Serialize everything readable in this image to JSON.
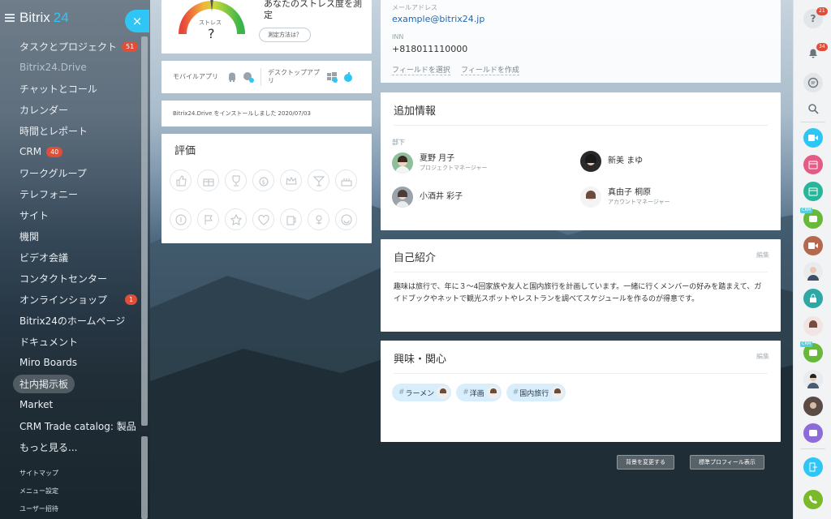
{
  "sidebar": {
    "logo_name": "Bitrix",
    "logo_num": "24",
    "items": [
      {
        "label": "タスクとプロジェクト",
        "badge": "51"
      },
      {
        "label": "Bitrix24.Drive"
      },
      {
        "label": "チャットとコール"
      },
      {
        "label": "カレンダー"
      },
      {
        "label": "時間とレポート"
      },
      {
        "label": "CRM",
        "badge": "40"
      },
      {
        "label": "ワークグループ"
      },
      {
        "label": "テレフォニー"
      },
      {
        "label": "サイト"
      },
      {
        "label": "機関"
      },
      {
        "label": "ビデオ会議"
      },
      {
        "label": "コンタクトセンター"
      },
      {
        "label": "オンラインショップ",
        "badge": "1"
      },
      {
        "label": "Bitrix24のホームページ"
      },
      {
        "label": "ドキュメント"
      },
      {
        "label": "Miro Boards"
      },
      {
        "label": "社内掲示板"
      },
      {
        "label": "Market"
      },
      {
        "label": "CRM Trade catalog: 製品"
      },
      {
        "label": "もっと見る..."
      }
    ],
    "footer": [
      "サイトマップ",
      "メニュー設定",
      "ユーザー招待"
    ],
    "close_glyph": "×"
  },
  "stress": {
    "title": "あなたのストレス度を測定",
    "gauge_label": "ストレス",
    "gauge_value": "?",
    "measure_button": "測定方法は？"
  },
  "apps": {
    "mobile_label": "モバイルアプリ",
    "desktop_label": "デスクトップアプリ"
  },
  "installed_text": "Bitrix24.Drive をインストールしました 2020/07/03",
  "awards": {
    "title": "評価"
  },
  "contact": {
    "email_label": "メールアドレス",
    "email": "example@bitrix24.jp",
    "inn_label": "INN",
    "inn": "+818011110000",
    "select_fields": "フィールドを選択",
    "create_field": "フィールドを作成"
  },
  "extra_info": {
    "title": "追加情報",
    "subordinates_label": "部下",
    "people": [
      {
        "name": "夏野 月子",
        "role": "プロジェクトマネージャー"
      },
      {
        "name": "新美 まゆ",
        "role": ""
      },
      {
        "name": "小酒井 彩子",
        "role": ""
      },
      {
        "name": "真由子 桐原",
        "role": "アカウントマネージャー"
      }
    ]
  },
  "intro": {
    "title": "自己紹介",
    "edit": "編集",
    "text": "趣味は旅行で、年に３〜4回家族や友人と国内旅行を計画しています。一緒に行くメンバーの好みを踏まえて、ガイドブックやネットで観光スポットやレストランを調べてスケジュールを作るのが得意です。"
  },
  "interests": {
    "title": "興味・関心",
    "edit": "編集",
    "tags": [
      "ラーメン",
      "洋画",
      "国内旅行"
    ]
  },
  "bottom": {
    "change_background": "背景を変更する",
    "standard_profile": "標準プロフィール表示"
  },
  "rightbar": {
    "help_badge": "21",
    "notif_badge": "34",
    "crm_label": "CRM"
  }
}
